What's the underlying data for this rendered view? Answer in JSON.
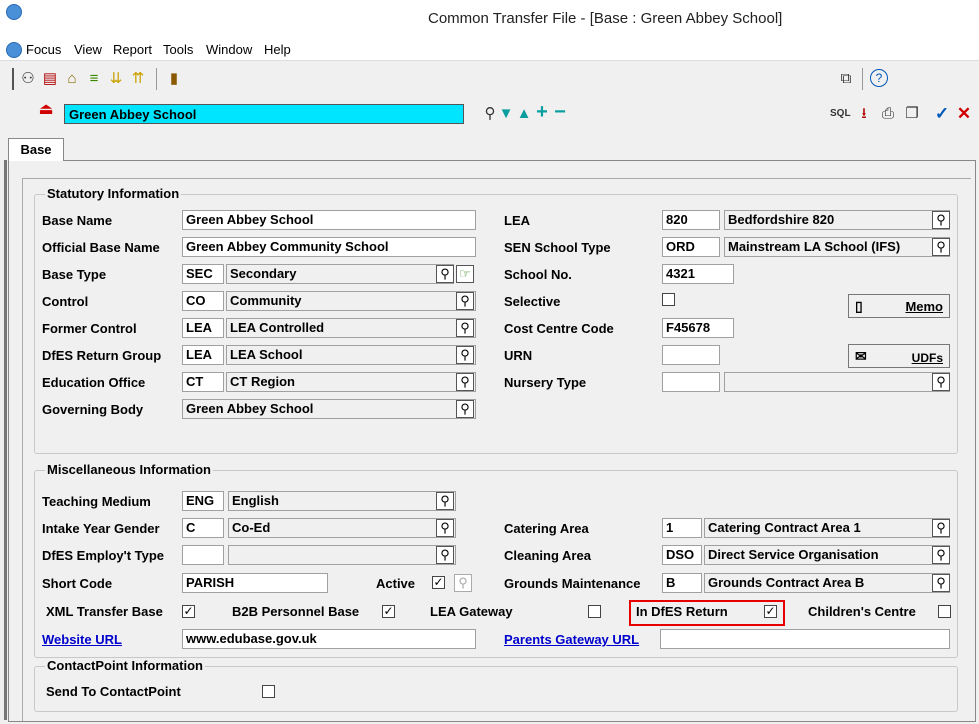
{
  "window": {
    "title": "Common Transfer File - [Base  : Green Abbey School]"
  },
  "menu": [
    "Focus",
    "View",
    "Report",
    "Tools",
    "Window",
    "Help"
  ],
  "record": {
    "name": "Green Abbey School"
  },
  "tabs": [
    "Base"
  ],
  "statutory": {
    "title": "Statutory Information",
    "base_name_label": "Base Name",
    "base_name": "Green Abbey School",
    "official_label": "Official Base Name",
    "official": "Green Abbey Community School",
    "base_type_label": "Base Type",
    "base_type_code": "SEC",
    "base_type": "Secondary",
    "control_label": "Control",
    "control_code": "CO",
    "control": "Community",
    "former_label": "Former Control",
    "former_code": "LEA",
    "former": "LEA Controlled",
    "dfes_group_label": "DfES Return Group",
    "dfes_group_code": "LEA",
    "dfes_group": "LEA School",
    "edu_label": "Education Office",
    "edu_code": "CT",
    "edu": "CT Region",
    "gov_label": "Governing Body",
    "gov": "Green Abbey School",
    "lea_label": "LEA",
    "lea_code": "820",
    "lea": "Bedfordshire 820",
    "sen_label": "SEN School Type",
    "sen_code": "ORD",
    "sen": "Mainstream LA School (IFS)",
    "schoolno_label": "School No.",
    "schoolno": "4321",
    "selective_label": "Selective",
    "cost_label": "Cost Centre Code",
    "cost": "F45678",
    "urn_label": "URN",
    "urn": "",
    "nursery_label": "Nursery Type",
    "nursery_code": "",
    "nursery": "",
    "memo_label": "Memo",
    "udfs_label": "UDFs"
  },
  "misc": {
    "title": "Miscellaneous Information",
    "teach_label": "Teaching Medium",
    "teach_code": "ENG",
    "teach": "English",
    "intake_label": "Intake Year Gender",
    "intake_code": "C",
    "intake": "Co-Ed",
    "employ_label": "DfES Employ't Type",
    "employ_code": "",
    "employ": "",
    "short_label": "Short Code",
    "short": "PARISH",
    "active_label": "Active",
    "catering_label": "Catering Area",
    "catering_code": "1",
    "catering": "Catering Contract Area 1",
    "cleaning_label": "Cleaning Area",
    "cleaning_code": "DSO",
    "cleaning": "Direct Service Organisation",
    "grounds_label": "Grounds Maintenance",
    "grounds_code": "B",
    "grounds": "Grounds Contract Area B",
    "xml_label": "XML Transfer Base",
    "b2b_label": "B2B Personnel Base",
    "leagw_label": "LEA Gateway",
    "indfes_label": "In DfES Return",
    "childrens_label": "Children's Centre",
    "website_label": "Website URL",
    "website": "www.edubase.gov.uk",
    "parents_label": "Parents Gateway URL",
    "parents": ""
  },
  "contact": {
    "title": "ContactPoint Information",
    "send_label": "Send To ContactPoint"
  },
  "colors": {
    "highlight": "#e60000",
    "record_bg": "#00e5ff",
    "link": "#0000cc"
  }
}
